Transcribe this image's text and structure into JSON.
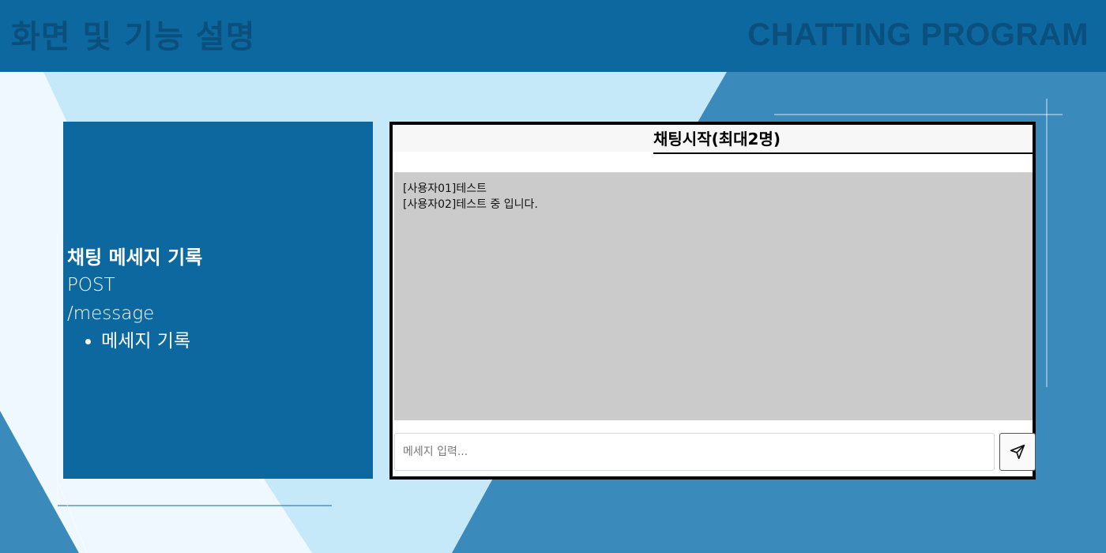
{
  "header": {
    "title_left": "화면 및 기능 설명",
    "title_right": "CHATTING PROGRAM"
  },
  "info": {
    "title": "채팅 메세지 기록",
    "method": "POST",
    "endpoint": "/message",
    "bullets": [
      "메세지 기록"
    ]
  },
  "chat": {
    "title": "채팅시작(최대2명)",
    "messages": [
      "[사용자01]테스트",
      "[사용자02]테스트 중 입니다."
    ],
    "input_placeholder": "메세지 입력...",
    "send_icon": "send-icon"
  },
  "colors": {
    "header_bg": "#0e68a0",
    "page_bg": "#c6e9fa",
    "panel_bg": "#0e68a0",
    "accent_dark": "#3a8abb",
    "chat_log_bg": "#cbcbcb"
  }
}
